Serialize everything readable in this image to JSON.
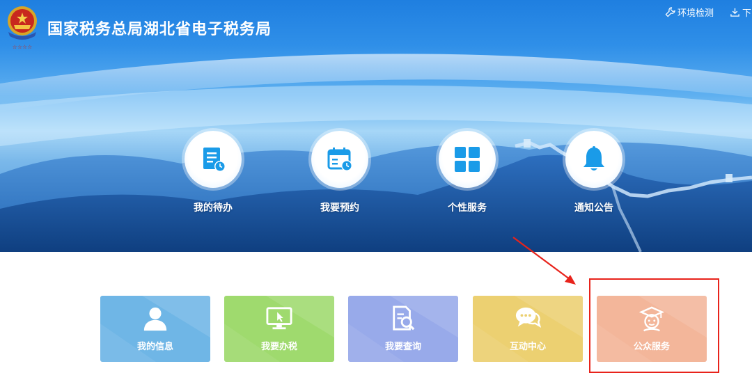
{
  "header": {
    "site_title": "国家税务总局湖北省电子税务局",
    "logo_icon": "tax-emblem-icon",
    "env_check_label": "环境检测",
    "download_label": "下"
  },
  "features": [
    {
      "label": "我的待办",
      "icon": "todo-document-icon"
    },
    {
      "label": "我要预约",
      "icon": "calendar-appointment-icon"
    },
    {
      "label": "个性服务",
      "icon": "grid-apps-icon"
    },
    {
      "label": "通知公告",
      "icon": "bell-icon"
    }
  ],
  "services": [
    {
      "label": "我的信息",
      "icon": "user-icon",
      "color": "#6fb6e6"
    },
    {
      "label": "我要办税",
      "icon": "monitor-cursor-icon",
      "color": "#9fda6e"
    },
    {
      "label": "我要查询",
      "icon": "document-search-icon",
      "color": "#98aaea"
    },
    {
      "label": "互动中心",
      "icon": "chat-bubbles-icon",
      "color": "#ecd071"
    },
    {
      "label": "公众服务",
      "icon": "scholar-person-icon",
      "color": "#f3b69a"
    }
  ],
  "annotation": {
    "highlight_color": "#e8231b",
    "highlighted_item": "公众服务"
  },
  "colors": {
    "banner_blue": "#2f8fe8",
    "icon_blue": "#1a9be8"
  }
}
